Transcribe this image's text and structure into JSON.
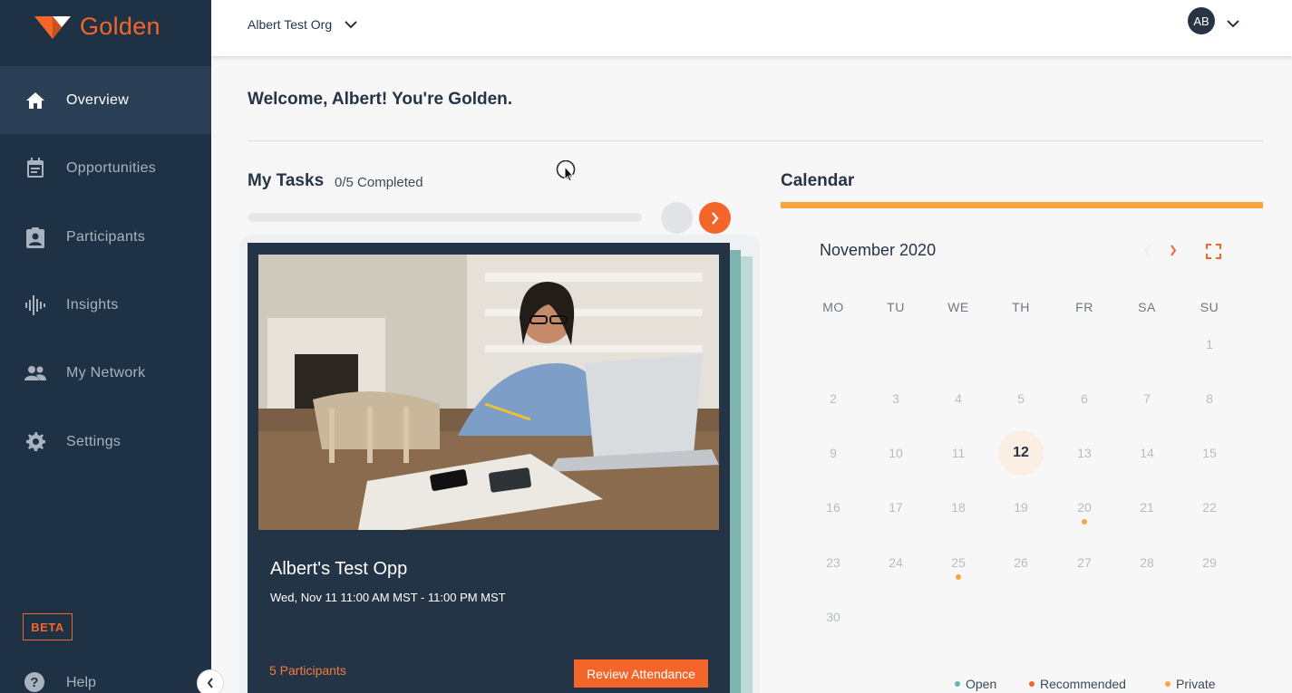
{
  "brand": {
    "name": "Golden",
    "color": "#f4652a"
  },
  "sidebar": {
    "items": [
      {
        "label": "Overview",
        "icon": "home-icon",
        "active": true
      },
      {
        "label": "Opportunities",
        "icon": "calendar-note-icon"
      },
      {
        "label": "Participants",
        "icon": "clipboard-person-icon"
      },
      {
        "label": "Insights",
        "icon": "waveform-icon"
      },
      {
        "label": "My Network",
        "icon": "people-icon"
      },
      {
        "label": "Settings",
        "icon": "gear-icon"
      }
    ],
    "beta": "BETA",
    "help": "Help"
  },
  "topbar": {
    "org": "Albert Test Org",
    "avatar_initials": "AB"
  },
  "main": {
    "welcome": "Welcome, Albert! You're Golden."
  },
  "tasks": {
    "title": "My Tasks",
    "completed": "0/5 Completed",
    "progress": 0,
    "card": {
      "title": "Albert's Test Opp",
      "time": "Wed, Nov 11 11:00 AM MST - 11:00 PM MST",
      "participants": "5 Participants",
      "button": "Review Attendance"
    }
  },
  "calendar": {
    "title": "Calendar",
    "month": "November 2020",
    "weekdays": [
      "MO",
      "TU",
      "WE",
      "TH",
      "FR",
      "SA",
      "SU"
    ],
    "weeks": [
      [
        "",
        "",
        "",
        "",
        "",
        "",
        "1"
      ],
      [
        "2",
        "3",
        "4",
        "5",
        "6",
        "7",
        "8"
      ],
      [
        "9",
        "10",
        "11",
        "12",
        "13",
        "14",
        "15"
      ],
      [
        "16",
        "17",
        "18",
        "19",
        "20",
        "21",
        "22"
      ],
      [
        "23",
        "24",
        "25",
        "26",
        "27",
        "28",
        "29"
      ],
      [
        "30",
        "",
        "",
        "",
        "",
        "",
        ""
      ]
    ],
    "today": "12",
    "event_days": [
      "20",
      "25"
    ],
    "legend": [
      {
        "label": "Open",
        "color": "#5fb8b3"
      },
      {
        "label": "Recommended",
        "color": "#f4652a"
      },
      {
        "label": "Private",
        "color": "#f7a541"
      }
    ]
  }
}
